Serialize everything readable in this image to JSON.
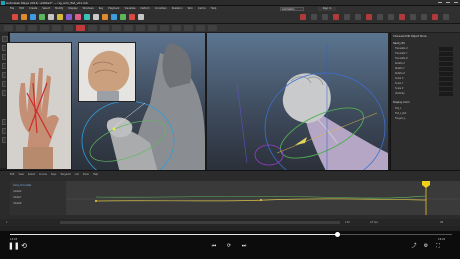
{
  "window": {
    "title": "Autodesk Maya 2016: untitled* — rig_arm_fist_v01.mb",
    "mode": "Animation",
    "signin": "Sign In"
  },
  "menu": [
    "File",
    "Edit",
    "Create",
    "Select",
    "Modify",
    "Display",
    "Windows",
    "Key",
    "Playback",
    "Visualize",
    "Deform",
    "Constrain",
    "Skeleton",
    "Skin",
    "Cache",
    "Help"
  ],
  "attribute_editor": {
    "tabs": [
      "Channels",
      "Edit",
      "Object",
      "Show"
    ],
    "object_name": "hand_ctrl",
    "attrs": [
      "Translate X",
      "Translate Y",
      "Translate Z",
      "Rotate X",
      "Rotate Y",
      "Rotate Z",
      "Scale X",
      "Scale Y",
      "Scale Z",
      "Visibility"
    ],
    "layer_tabs": [
      "Display",
      "Anim"
    ],
    "layers": [
      "Fist_L",
      "Fist_L_Rot",
      "Fingers_L"
    ]
  },
  "graph_editor": {
    "menus": [
      "Edit",
      "View",
      "Select",
      "Curves",
      "Keys",
      "Tangents",
      "List",
      "Show",
      "Help"
    ],
    "outliner_items": [
      "hand_ctrl.rotate",
      "rotateX",
      "rotateY",
      "rotateZ"
    ]
  },
  "timeline": {
    "start": "1",
    "end": "120",
    "current": "96",
    "fps": "24 fps"
  },
  "video": {
    "progress": 0.74,
    "elapsed": "12:03",
    "duration": "16:20",
    "play_icon": "pause-icon"
  }
}
